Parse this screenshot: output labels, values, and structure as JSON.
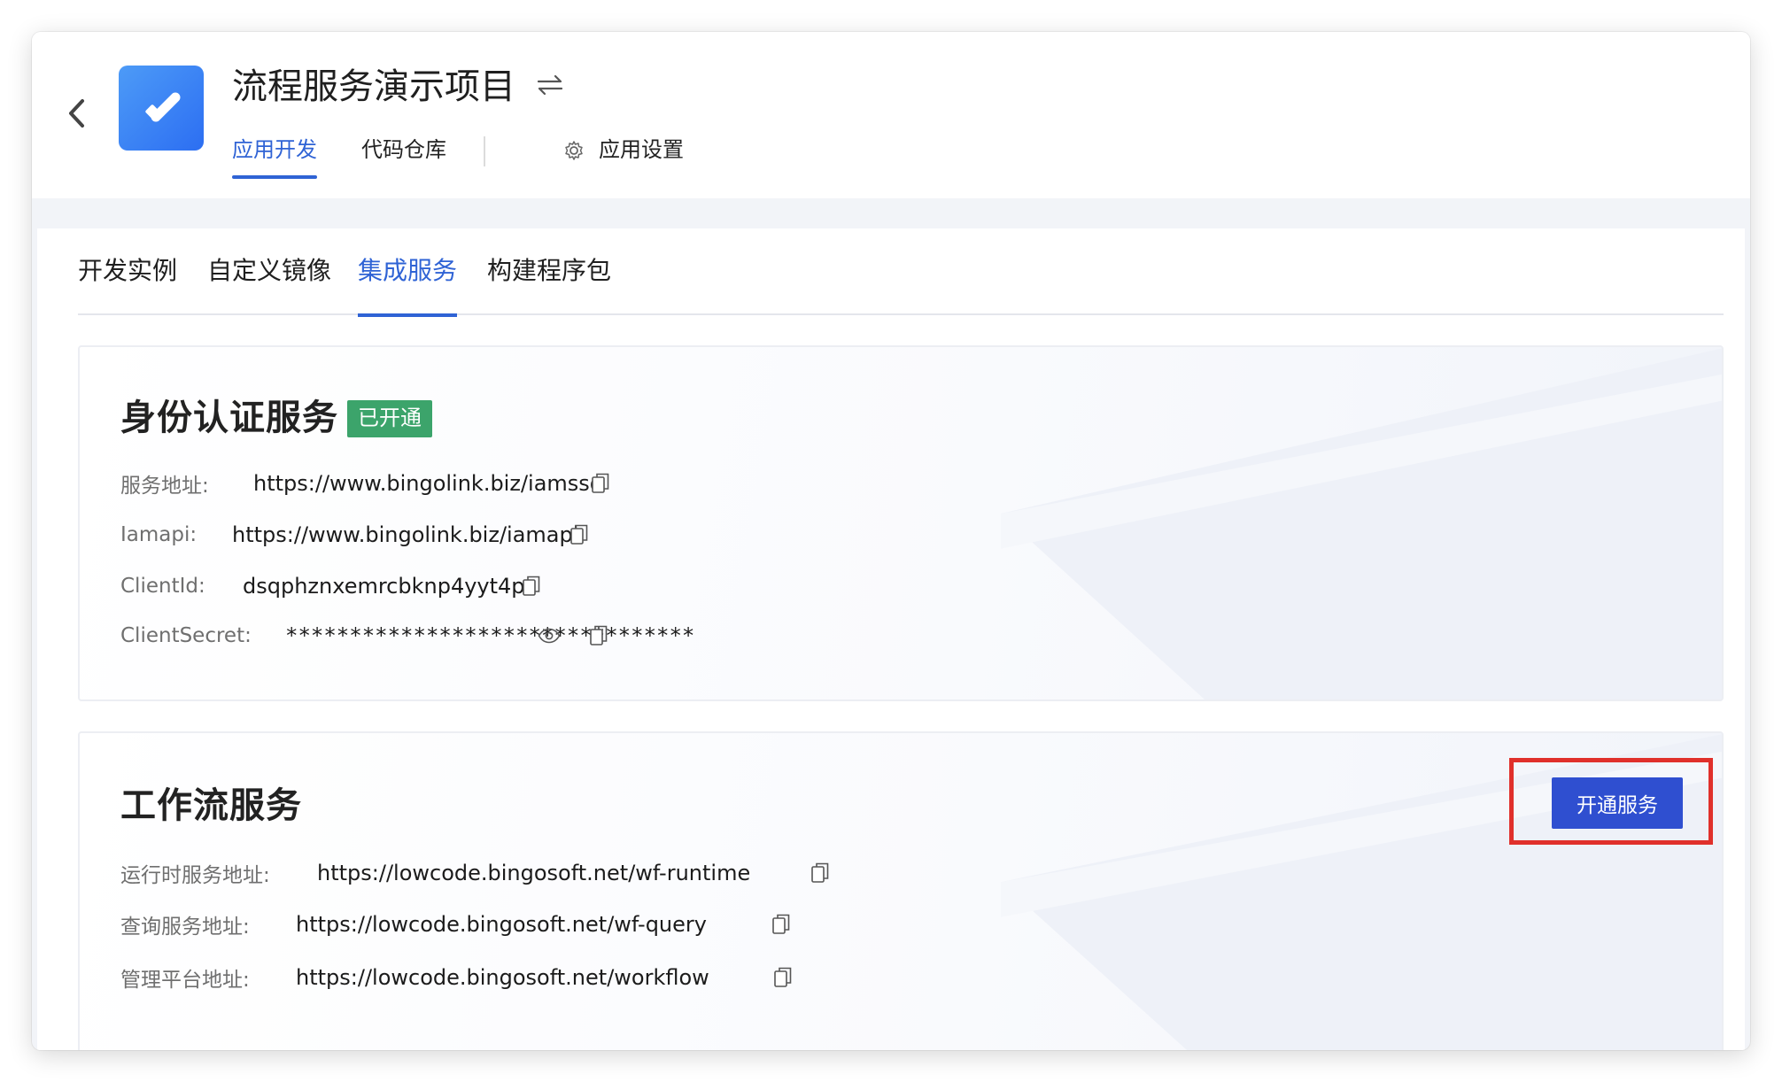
{
  "header": {
    "app_name": "流程服务演示项目",
    "nav": [
      {
        "label": "应用开发",
        "active": true
      },
      {
        "label": "代码仓库",
        "active": false
      },
      {
        "label": "应用设置",
        "active": false
      }
    ]
  },
  "tabs": [
    {
      "label": "开发实例",
      "active": false
    },
    {
      "label": "自定义镜像",
      "active": false
    },
    {
      "label": "集成服务",
      "active": true
    },
    {
      "label": "构建程序包",
      "active": false
    }
  ],
  "identity_service": {
    "title": "身份认证服务",
    "status_badge": "已开通",
    "fields": [
      {
        "label": "服务地址:",
        "value": "https://www.bingolink.biz/iamsso"
      },
      {
        "label": "Iamapi:",
        "value": "https://www.bingolink.biz/iamapi"
      },
      {
        "label": "ClientId:",
        "value": "dsqphznxemrcbknp4yyt4p"
      },
      {
        "label": "ClientSecret:",
        "value": "********************************"
      }
    ]
  },
  "workflow_service": {
    "title": "工作流服务",
    "open_button": "开通服务",
    "fields": [
      {
        "label": "运行时服务地址:",
        "value": "https://lowcode.bingosoft.net/wf-runtime"
      },
      {
        "label": "查询服务地址:",
        "value": "https://lowcode.bingosoft.net/wf-query"
      },
      {
        "label": "管理平台地址:",
        "value": "https://lowcode.bingosoft.net/workflow"
      }
    ]
  },
  "icons": {
    "back": "chevron-left-icon",
    "app": "check-icon",
    "switch": "swap-arrows-icon",
    "settings": "gear-icon",
    "copy": "copy-icon",
    "reveal": "eye-icon"
  },
  "colors": {
    "accent": "#2f63d5",
    "button": "#2f4fd0",
    "badge": "#3ca46b",
    "highlight": "#e0302b"
  }
}
